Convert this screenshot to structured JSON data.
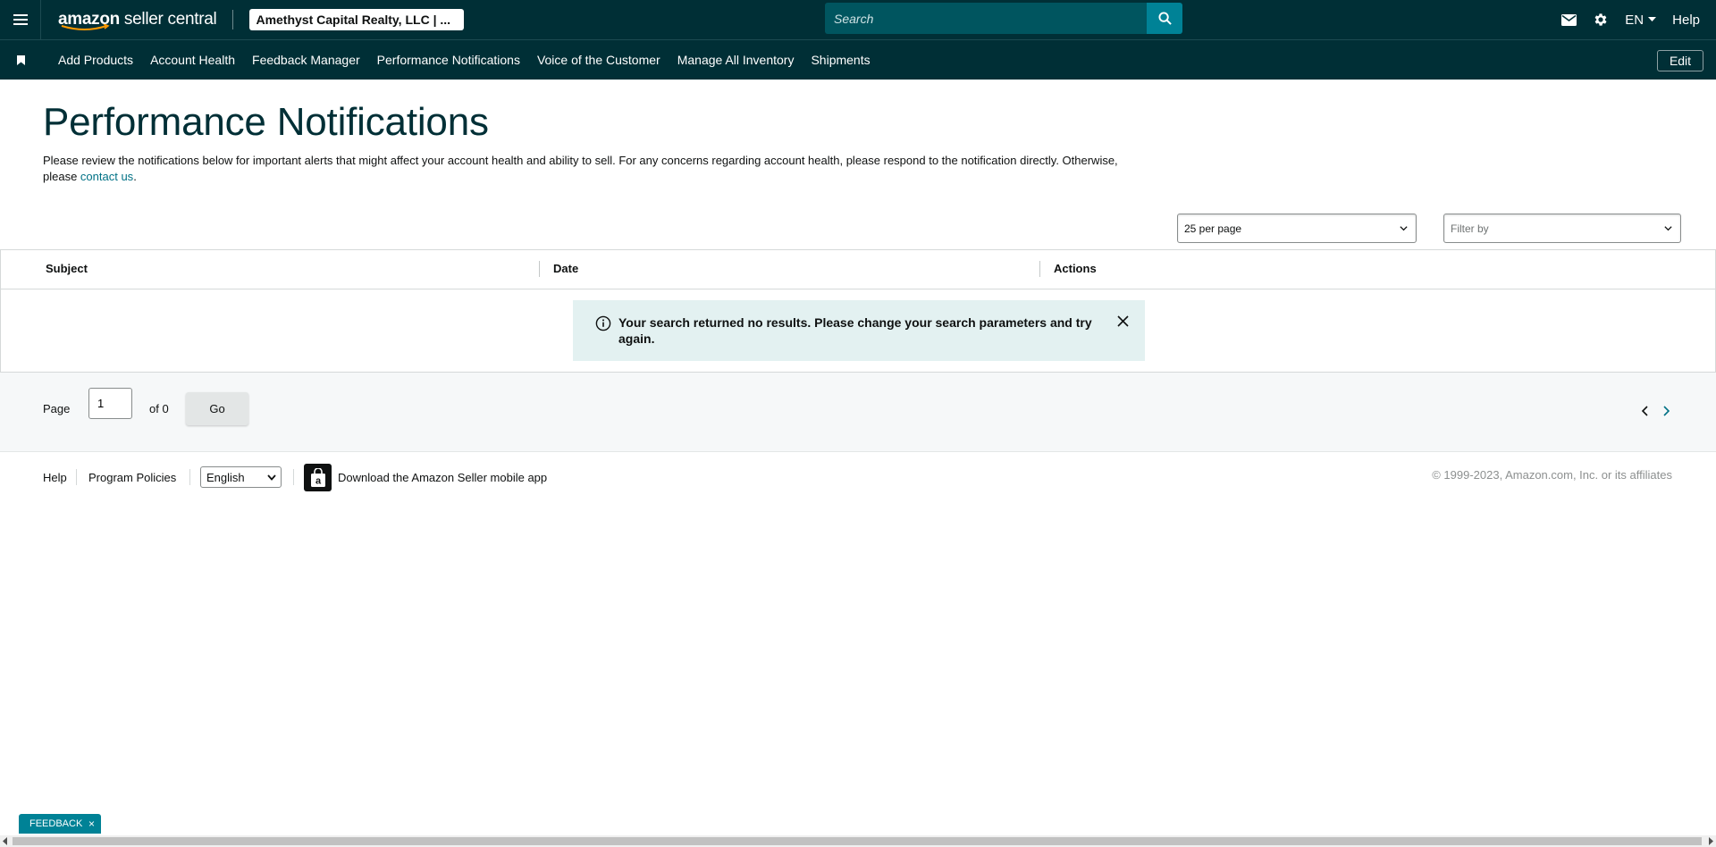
{
  "header": {
    "logo_text_a": "amazon",
    "logo_text_b": " seller central",
    "account_name": "Amethyst Capital Realty, LLC | ...",
    "search_placeholder": "Search",
    "lang": "EN",
    "help": "Help"
  },
  "nav": {
    "items": [
      "Add Products",
      "Account Health",
      "Feedback Manager",
      "Performance Notifications",
      "Voice of the Customer",
      "Manage All Inventory",
      "Shipments"
    ],
    "edit": "Edit"
  },
  "page": {
    "title": "Performance Notifications",
    "desc_before": "Please review the notifications below for important alerts that might affect your account health and ability to sell. For any concerns regarding account health, please respond to the notification directly. Otherwise, please ",
    "desc_link": "contact us",
    "desc_after": "."
  },
  "controls": {
    "per_page": "25 per page",
    "filter_placeholder": "Filter by"
  },
  "table": {
    "columns": [
      "Subject",
      "Date",
      "Actions"
    ],
    "alert": "Your search returned no results. Please change your search parameters and try again."
  },
  "pager": {
    "page_label": "Page",
    "page_value": "1",
    "of_label": "of 0",
    "go": "Go"
  },
  "footer": {
    "help": "Help",
    "policies": "Program Policies",
    "language": "English",
    "app": "Download the Amazon Seller mobile app",
    "copyright": "© 1999-2023, Amazon.com, Inc. or its affiliates"
  },
  "feedback": {
    "label": "FEEDBACK",
    "close": "×"
  },
  "colors": {
    "header_bg": "#002f36",
    "accent": "#008296",
    "link": "#007185",
    "alert_bg": "#e3f1f1"
  },
  "icons": [
    "menu-icon",
    "search-icon",
    "mail-icon",
    "gear-icon",
    "bookmark-icon",
    "info-icon",
    "close-icon",
    "chevron-left-icon",
    "chevron-right-icon",
    "app-bag-icon"
  ]
}
